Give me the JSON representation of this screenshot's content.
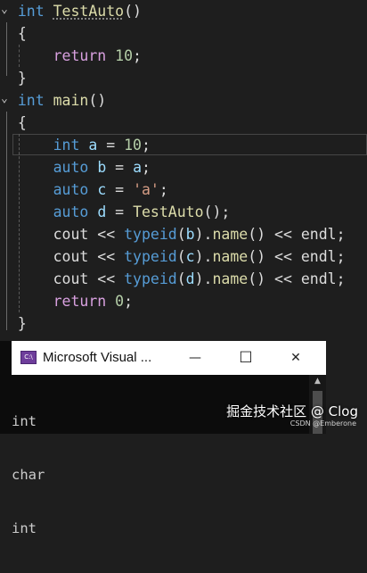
{
  "editor": {
    "lines": [
      {
        "fold": "⌄",
        "tokens": [
          {
            "t": "int",
            "c": "kw"
          },
          {
            "t": " ",
            "c": "plain"
          },
          {
            "t": "TestAuto",
            "c": "fn",
            "squiggle": true
          },
          {
            "t": "()",
            "c": "plain"
          }
        ]
      },
      {
        "fold": "",
        "tokens": [
          {
            "t": "{",
            "c": "plain"
          }
        ]
      },
      {
        "fold": "",
        "tokens": [
          {
            "t": "    ",
            "c": "plain"
          },
          {
            "t": "return",
            "c": "purple"
          },
          {
            "t": " ",
            "c": "plain"
          },
          {
            "t": "10",
            "c": "num"
          },
          {
            "t": ";",
            "c": "plain"
          }
        ]
      },
      {
        "fold": "",
        "tokens": [
          {
            "t": "}",
            "c": "plain"
          }
        ]
      },
      {
        "fold": "⌄",
        "tokens": [
          {
            "t": "int",
            "c": "kw"
          },
          {
            "t": " ",
            "c": "plain"
          },
          {
            "t": "main",
            "c": "fn"
          },
          {
            "t": "()",
            "c": "plain"
          }
        ]
      },
      {
        "fold": "",
        "tokens": [
          {
            "t": "{",
            "c": "plain"
          }
        ]
      },
      {
        "fold": "",
        "tokens": [
          {
            "t": "    ",
            "c": "plain"
          },
          {
            "t": "int",
            "c": "kw"
          },
          {
            "t": " ",
            "c": "plain"
          },
          {
            "t": "a",
            "c": "var"
          },
          {
            "t": " = ",
            "c": "plain"
          },
          {
            "t": "10",
            "c": "num"
          },
          {
            "t": ";",
            "c": "plain"
          }
        ]
      },
      {
        "fold": "",
        "tokens": [
          {
            "t": "    ",
            "c": "plain"
          },
          {
            "t": "auto",
            "c": "kw"
          },
          {
            "t": " ",
            "c": "plain"
          },
          {
            "t": "b",
            "c": "var"
          },
          {
            "t": " = ",
            "c": "plain"
          },
          {
            "t": "a",
            "c": "var"
          },
          {
            "t": ";",
            "c": "plain"
          }
        ]
      },
      {
        "fold": "",
        "tokens": [
          {
            "t": "    ",
            "c": "plain"
          },
          {
            "t": "auto",
            "c": "kw"
          },
          {
            "t": " ",
            "c": "plain"
          },
          {
            "t": "c",
            "c": "var"
          },
          {
            "t": " = ",
            "c": "plain"
          },
          {
            "t": "'a'",
            "c": "str"
          },
          {
            "t": ";",
            "c": "plain"
          }
        ]
      },
      {
        "fold": "",
        "tokens": [
          {
            "t": "    ",
            "c": "plain"
          },
          {
            "t": "auto",
            "c": "kw"
          },
          {
            "t": " ",
            "c": "plain"
          },
          {
            "t": "d",
            "c": "var"
          },
          {
            "t": " = ",
            "c": "plain"
          },
          {
            "t": "TestAuto",
            "c": "fn"
          },
          {
            "t": "();",
            "c": "plain"
          }
        ]
      },
      {
        "fold": "",
        "tokens": [
          {
            "t": "    ",
            "c": "plain"
          },
          {
            "t": "cout",
            "c": "plain"
          },
          {
            "t": " << ",
            "c": "plain"
          },
          {
            "t": "typeid",
            "c": "kw"
          },
          {
            "t": "(",
            "c": "plain"
          },
          {
            "t": "b",
            "c": "var"
          },
          {
            "t": ").",
            "c": "plain"
          },
          {
            "t": "name",
            "c": "fn"
          },
          {
            "t": "() << ",
            "c": "plain"
          },
          {
            "t": "endl",
            "c": "plain"
          },
          {
            "t": ";",
            "c": "plain"
          }
        ]
      },
      {
        "fold": "",
        "tokens": [
          {
            "t": "    ",
            "c": "plain"
          },
          {
            "t": "cout",
            "c": "plain"
          },
          {
            "t": " << ",
            "c": "plain"
          },
          {
            "t": "typeid",
            "c": "kw"
          },
          {
            "t": "(",
            "c": "plain"
          },
          {
            "t": "c",
            "c": "var"
          },
          {
            "t": ").",
            "c": "plain"
          },
          {
            "t": "name",
            "c": "fn"
          },
          {
            "t": "() << ",
            "c": "plain"
          },
          {
            "t": "endl",
            "c": "plain"
          },
          {
            "t": ";",
            "c": "plain"
          }
        ]
      },
      {
        "fold": "",
        "tokens": [
          {
            "t": "    ",
            "c": "plain"
          },
          {
            "t": "cout",
            "c": "plain"
          },
          {
            "t": " << ",
            "c": "plain"
          },
          {
            "t": "typeid",
            "c": "kw"
          },
          {
            "t": "(",
            "c": "plain"
          },
          {
            "t": "d",
            "c": "var"
          },
          {
            "t": ").",
            "c": "plain"
          },
          {
            "t": "name",
            "c": "fn"
          },
          {
            "t": "() << ",
            "c": "plain"
          },
          {
            "t": "endl",
            "c": "plain"
          },
          {
            "t": ";",
            "c": "plain"
          }
        ]
      },
      {
        "fold": "",
        "tokens": [
          {
            "t": "    ",
            "c": "plain"
          },
          {
            "t": "return",
            "c": "purple"
          },
          {
            "t": " ",
            "c": "plain"
          },
          {
            "t": "0",
            "c": "num"
          },
          {
            "t": ";",
            "c": "plain"
          }
        ]
      },
      {
        "fold": "",
        "tokens": [
          {
            "t": "}",
            "c": "plain"
          }
        ]
      }
    ]
  },
  "console": {
    "icon_label": "C:\\",
    "title": "Microsoft Visual ...",
    "minimize": "—",
    "maximize": "☐",
    "close": "✕",
    "output": [
      "int",
      "char",
      "int"
    ]
  },
  "watermark": {
    "main": "掘金技术社区 @ Clog",
    "sub": "CSDN @Emberone"
  },
  "colors": {
    "editor_bg": "#1e1e1e",
    "keyword": "#569cd6",
    "function": "#dcdcaa",
    "number": "#b5cea8",
    "string": "#d69d85",
    "control": "#d8a0df",
    "variable": "#9cdcfe"
  }
}
